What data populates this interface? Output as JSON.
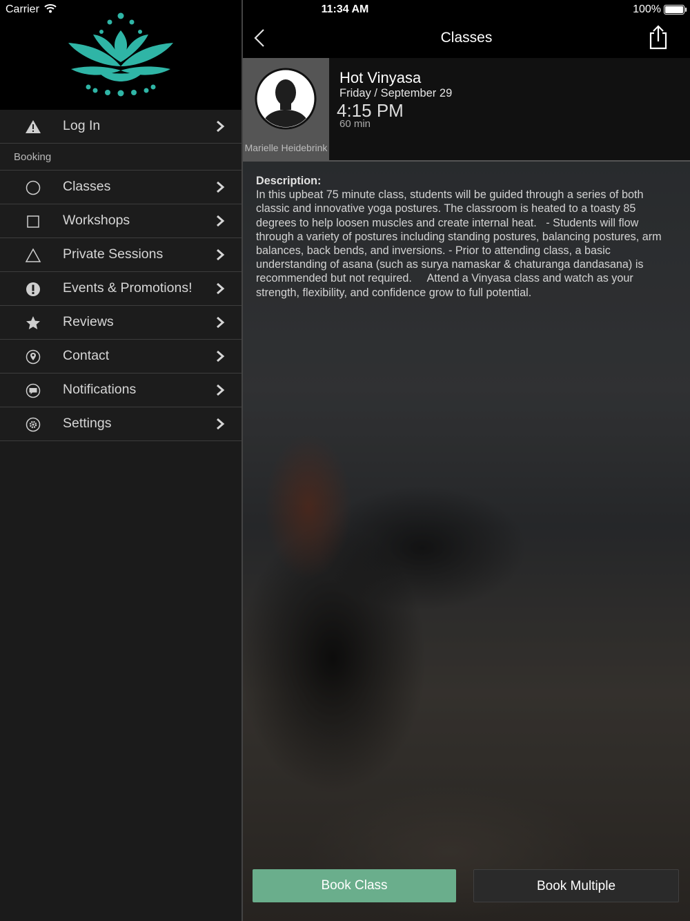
{
  "status_bar": {
    "carrier": "Carrier",
    "time": "11:34 AM",
    "battery": "100%"
  },
  "colors": {
    "logo_teal": "#2fb5a6",
    "book_button": "#6aae8c",
    "sidebar_bg": "#1c1c1c"
  },
  "sidebar": {
    "login": {
      "label": "Log In",
      "icon": "warning-icon"
    },
    "section_booking": "Booking",
    "items": [
      {
        "label": "Classes",
        "icon": "circle-icon"
      },
      {
        "label": "Workshops",
        "icon": "square-icon"
      },
      {
        "label": "Private Sessions",
        "icon": "triangle-icon"
      },
      {
        "label": "Events & Promotions!",
        "icon": "exclamation-icon"
      },
      {
        "label": "Reviews",
        "icon": "star-icon"
      },
      {
        "label": "Contact",
        "icon": "location-pin-icon"
      },
      {
        "label": "Notifications",
        "icon": "chat-bubble-icon"
      },
      {
        "label": "Settings",
        "icon": "gear-icon"
      }
    ]
  },
  "nav": {
    "title": "Classes"
  },
  "class": {
    "instructor": "Marielle Heidebrink",
    "name": "Hot Vinyasa",
    "date": "Friday / September 29",
    "time": "4:15 PM",
    "duration": "60 min",
    "description_label": "Description:",
    "description": "In this upbeat 75 minute class, students will be guided through a series of both classic and innovative yoga postures. The classroom is heated to a toasty 85 degrees to help loosen muscles and create internal heat.   - Students will flow through a variety of postures including standing postures, balancing postures, arm balances, back bends, and inversions. - Prior to attending class, a basic understanding of asana (such as surya namaskar & chaturanga dandasana) is recommended but not required.     Attend a Vinyasa class and watch as your strength, flexibility, and confidence grow to full potential."
  },
  "buttons": {
    "book_class": "Book Class",
    "book_multiple": "Book Multiple"
  }
}
